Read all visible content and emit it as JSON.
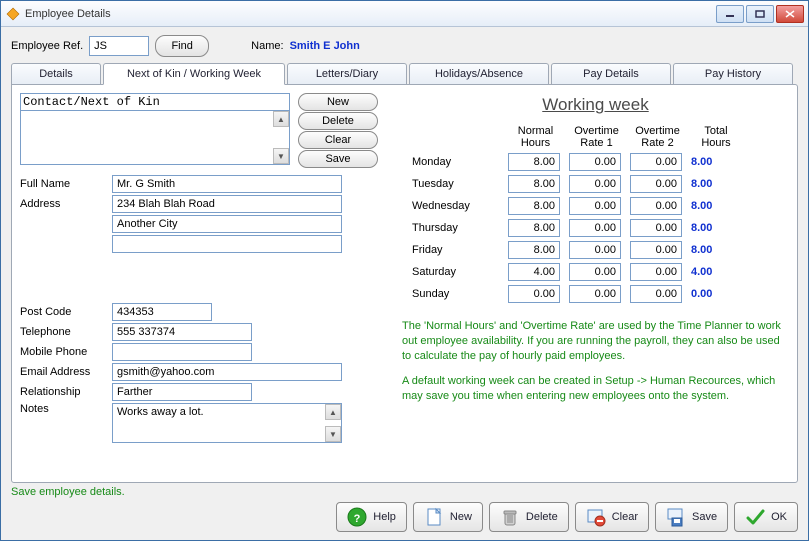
{
  "window": {
    "title": "Employee Details"
  },
  "toprow": {
    "ref_label": "Employee Ref.",
    "ref_value": "JS",
    "find_label": "Find",
    "name_label": "Name:",
    "name_value": "Smith E John"
  },
  "tabs": [
    "Details",
    "Next of Kin / Working Week",
    "Letters/Diary",
    "Holidays/Absence",
    "Pay Details",
    "Pay History"
  ],
  "active_tab_index": 1,
  "kin": {
    "header_value": "Contact/Next of Kin",
    "buttons": {
      "new": "New",
      "delete": "Delete",
      "clear": "Clear",
      "save": "Save"
    },
    "fields": {
      "full_name_label": "Full Name",
      "full_name": "Mr. G Smith",
      "address_label": "Address",
      "address1": "234 Blah Blah Road",
      "address2": "Another City",
      "address3": "",
      "postcode_label": "Post Code",
      "postcode": "434353",
      "telephone_label": "Telephone",
      "telephone": "555 337374",
      "mobile_label": "Mobile Phone",
      "mobile": "",
      "email_label": "Email Address",
      "email": "gsmith@yahoo.com",
      "relationship_label": "Relationship",
      "relationship": "Farther",
      "notes_label": "Notes",
      "notes": "Works away a lot."
    }
  },
  "working_week": {
    "title": "Working week",
    "headers": {
      "normal": "Normal Hours",
      "ot1": "Overtime Rate 1",
      "ot2": "Overtime Rate 2",
      "total": "Total Hours"
    },
    "rows": [
      {
        "day": "Monday",
        "normal": "8.00",
        "ot1": "0.00",
        "ot2": "0.00",
        "total": "8.00"
      },
      {
        "day": "Tuesday",
        "normal": "8.00",
        "ot1": "0.00",
        "ot2": "0.00",
        "total": "8.00"
      },
      {
        "day": "Wednesday",
        "normal": "8.00",
        "ot1": "0.00",
        "ot2": "0.00",
        "total": "8.00"
      },
      {
        "day": "Thursday",
        "normal": "8.00",
        "ot1": "0.00",
        "ot2": "0.00",
        "total": "8.00"
      },
      {
        "day": "Friday",
        "normal": "8.00",
        "ot1": "0.00",
        "ot2": "0.00",
        "total": "8.00"
      },
      {
        "day": "Saturday",
        "normal": "4.00",
        "ot1": "0.00",
        "ot2": "0.00",
        "total": "4.00"
      },
      {
        "day": "Sunday",
        "normal": "0.00",
        "ot1": "0.00",
        "ot2": "0.00",
        "total": "0.00"
      }
    ],
    "help1": "The 'Normal Hours' and 'Overtime Rate' are used by the Time Planner to work out employee availability.   If you are running the payroll, they can also be used to calculate the pay of hourly paid employees.",
    "help2": "A default working week can be created in Setup -> Human Recources, which may save you time when entering new employees onto the system."
  },
  "status": "Save employee details.",
  "bottom": {
    "help": "Help",
    "new": "New",
    "delete": "Delete",
    "clear": "Clear",
    "save": "Save",
    "ok": "OK"
  }
}
